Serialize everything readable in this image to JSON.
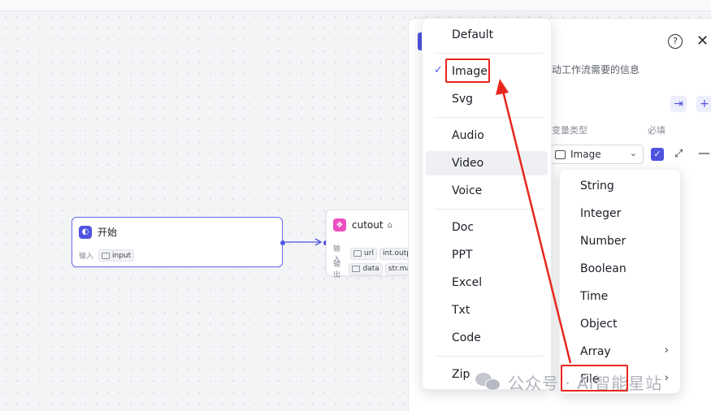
{
  "nodes": {
    "start": {
      "title": "开始",
      "input_label": "输入",
      "input_tag": "input"
    },
    "cutout": {
      "title": "cutout",
      "input_label": "输入",
      "input_tags": [
        "url",
        "int.outp"
      ],
      "output_label": "输出",
      "output_tags": [
        "data",
        "str.ma"
      ]
    }
  },
  "panel": {
    "hint_text": "动工作流需要的信息",
    "col_type_label": "变量类型",
    "col_required_label": "必填",
    "type_value": "Image",
    "required_checked": true
  },
  "type_menu": {
    "items": [
      "Default",
      "Image",
      "Svg",
      "Audio",
      "Video",
      "Voice",
      "Doc",
      "PPT",
      "Excel",
      "Txt",
      "Code",
      "Zip"
    ],
    "selected": "Image",
    "hovered": "Video"
  },
  "type_submenu": {
    "items": [
      "String",
      "Integer",
      "Number",
      "Boolean",
      "Time",
      "Object",
      "Array",
      "File"
    ],
    "has_submenu": [
      "Array",
      "File"
    ]
  },
  "icons": {
    "help": "help-circle-icon",
    "close": "close-icon",
    "check": "check-icon",
    "expand": "expand-icon",
    "remove": "minus-icon",
    "add": "plus-icon",
    "import": "import-icon"
  },
  "watermark": {
    "text": "公众号 · Ai智能星站"
  },
  "colors": {
    "accent": "#4f53e0",
    "annotation": "#e8261d"
  }
}
